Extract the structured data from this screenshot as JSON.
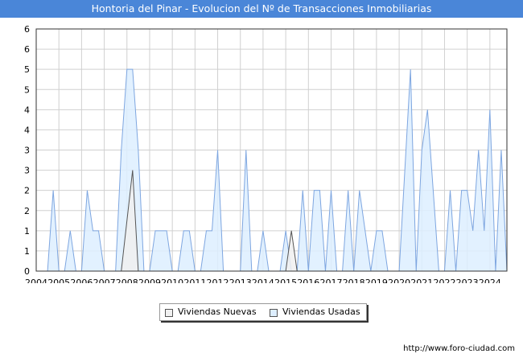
{
  "header": {
    "title": "Hontoria del Pinar - Evolucion del Nº de Transacciones Inmobiliarias"
  },
  "legend": {
    "nuevas_label": "Viviendas Nuevas",
    "usadas_label": "Viviendas Usadas"
  },
  "footer": {
    "url": "http://www.foro-ciudad.com"
  },
  "colors": {
    "title_bg": "#4a86d8",
    "nuevas_fill": "#f0f0f0",
    "nuevas_stroke": "#555555",
    "usadas_fill": "#ddeeff",
    "usadas_stroke": "#7ea6e0",
    "grid": "#d0d0d0"
  },
  "chart_data": {
    "type": "area",
    "title": "Hontoria del Pinar - Evolucion del Nº de Transacciones Inmobiliarias",
    "xlabel": "",
    "ylabel": "",
    "xlim": [
      2004.0,
      2024.75
    ],
    "ylim": [
      0,
      6
    ],
    "x_ticks": [
      2004,
      2005,
      2006,
      2007,
      2008,
      2009,
      2010,
      2011,
      2012,
      2013,
      2014,
      2015,
      2016,
      2017,
      2018,
      2019,
      2020,
      2021,
      2022,
      2023,
      2024
    ],
    "y_ticks": [
      0,
      1,
      2,
      3,
      4,
      5,
      6
    ],
    "y_tick_labels": [
      "0",
      "1",
      "1",
      "2",
      "2",
      "3",
      "3",
      "4",
      "4",
      "5",
      "5",
      "6"
    ],
    "grid": true,
    "legend_position": "bottom-center",
    "series": [
      {
        "name": "Viviendas Nuevas",
        "points": [
          [
            2004.5,
            0
          ],
          [
            2007.75,
            0
          ],
          [
            2008.25,
            2.5
          ],
          [
            2008.5,
            0
          ],
          [
            2015.0,
            0
          ],
          [
            2015.25,
            1
          ],
          [
            2015.5,
            0
          ],
          [
            2024.75,
            0
          ]
        ]
      },
      {
        "name": "Viviendas Usadas",
        "points": [
          [
            2004.5,
            0
          ],
          [
            2004.75,
            2
          ],
          [
            2005.0,
            0
          ],
          [
            2005.25,
            0
          ],
          [
            2005.5,
            1
          ],
          [
            2005.75,
            0
          ],
          [
            2006.0,
            0
          ],
          [
            2006.25,
            2
          ],
          [
            2006.5,
            1
          ],
          [
            2006.75,
            1
          ],
          [
            2007.0,
            0
          ],
          [
            2007.5,
            0
          ],
          [
            2007.75,
            3
          ],
          [
            2008.0,
            5
          ],
          [
            2008.25,
            5
          ],
          [
            2008.5,
            3
          ],
          [
            2008.75,
            0
          ],
          [
            2009.0,
            0
          ],
          [
            2009.25,
            1
          ],
          [
            2009.5,
            1
          ],
          [
            2009.75,
            1
          ],
          [
            2010.0,
            0
          ],
          [
            2010.25,
            0
          ],
          [
            2010.5,
            1
          ],
          [
            2010.75,
            1
          ],
          [
            2011.0,
            0
          ],
          [
            2011.25,
            0
          ],
          [
            2011.5,
            1
          ],
          [
            2011.75,
            1
          ],
          [
            2012.0,
            3
          ],
          [
            2012.25,
            0
          ],
          [
            2013.0,
            0
          ],
          [
            2013.25,
            3
          ],
          [
            2013.5,
            0
          ],
          [
            2013.75,
            0
          ],
          [
            2014.0,
            1
          ],
          [
            2014.25,
            0
          ],
          [
            2014.75,
            0
          ],
          [
            2015.0,
            1
          ],
          [
            2015.25,
            0
          ],
          [
            2015.5,
            0
          ],
          [
            2015.75,
            2
          ],
          [
            2016.0,
            0
          ],
          [
            2016.25,
            2
          ],
          [
            2016.5,
            2
          ],
          [
            2016.75,
            0
          ],
          [
            2017.0,
            2
          ],
          [
            2017.25,
            0
          ],
          [
            2017.5,
            0
          ],
          [
            2017.75,
            2
          ],
          [
            2018.0,
            0
          ],
          [
            2018.25,
            2
          ],
          [
            2018.5,
            1
          ],
          [
            2018.75,
            0
          ],
          [
            2019.0,
            1
          ],
          [
            2019.25,
            1
          ],
          [
            2019.5,
            0
          ],
          [
            2020.0,
            0
          ],
          [
            2020.5,
            5
          ],
          [
            2020.75,
            0
          ],
          [
            2021.0,
            3
          ],
          [
            2021.25,
            4
          ],
          [
            2021.5,
            2
          ],
          [
            2021.75,
            0
          ],
          [
            2022.0,
            0
          ],
          [
            2022.25,
            2
          ],
          [
            2022.5,
            0
          ],
          [
            2022.75,
            2
          ],
          [
            2023.0,
            2
          ],
          [
            2023.25,
            1
          ],
          [
            2023.5,
            3
          ],
          [
            2023.75,
            1
          ],
          [
            2024.0,
            4
          ],
          [
            2024.25,
            0
          ],
          [
            2024.5,
            3
          ],
          [
            2024.75,
            0
          ]
        ]
      }
    ]
  }
}
